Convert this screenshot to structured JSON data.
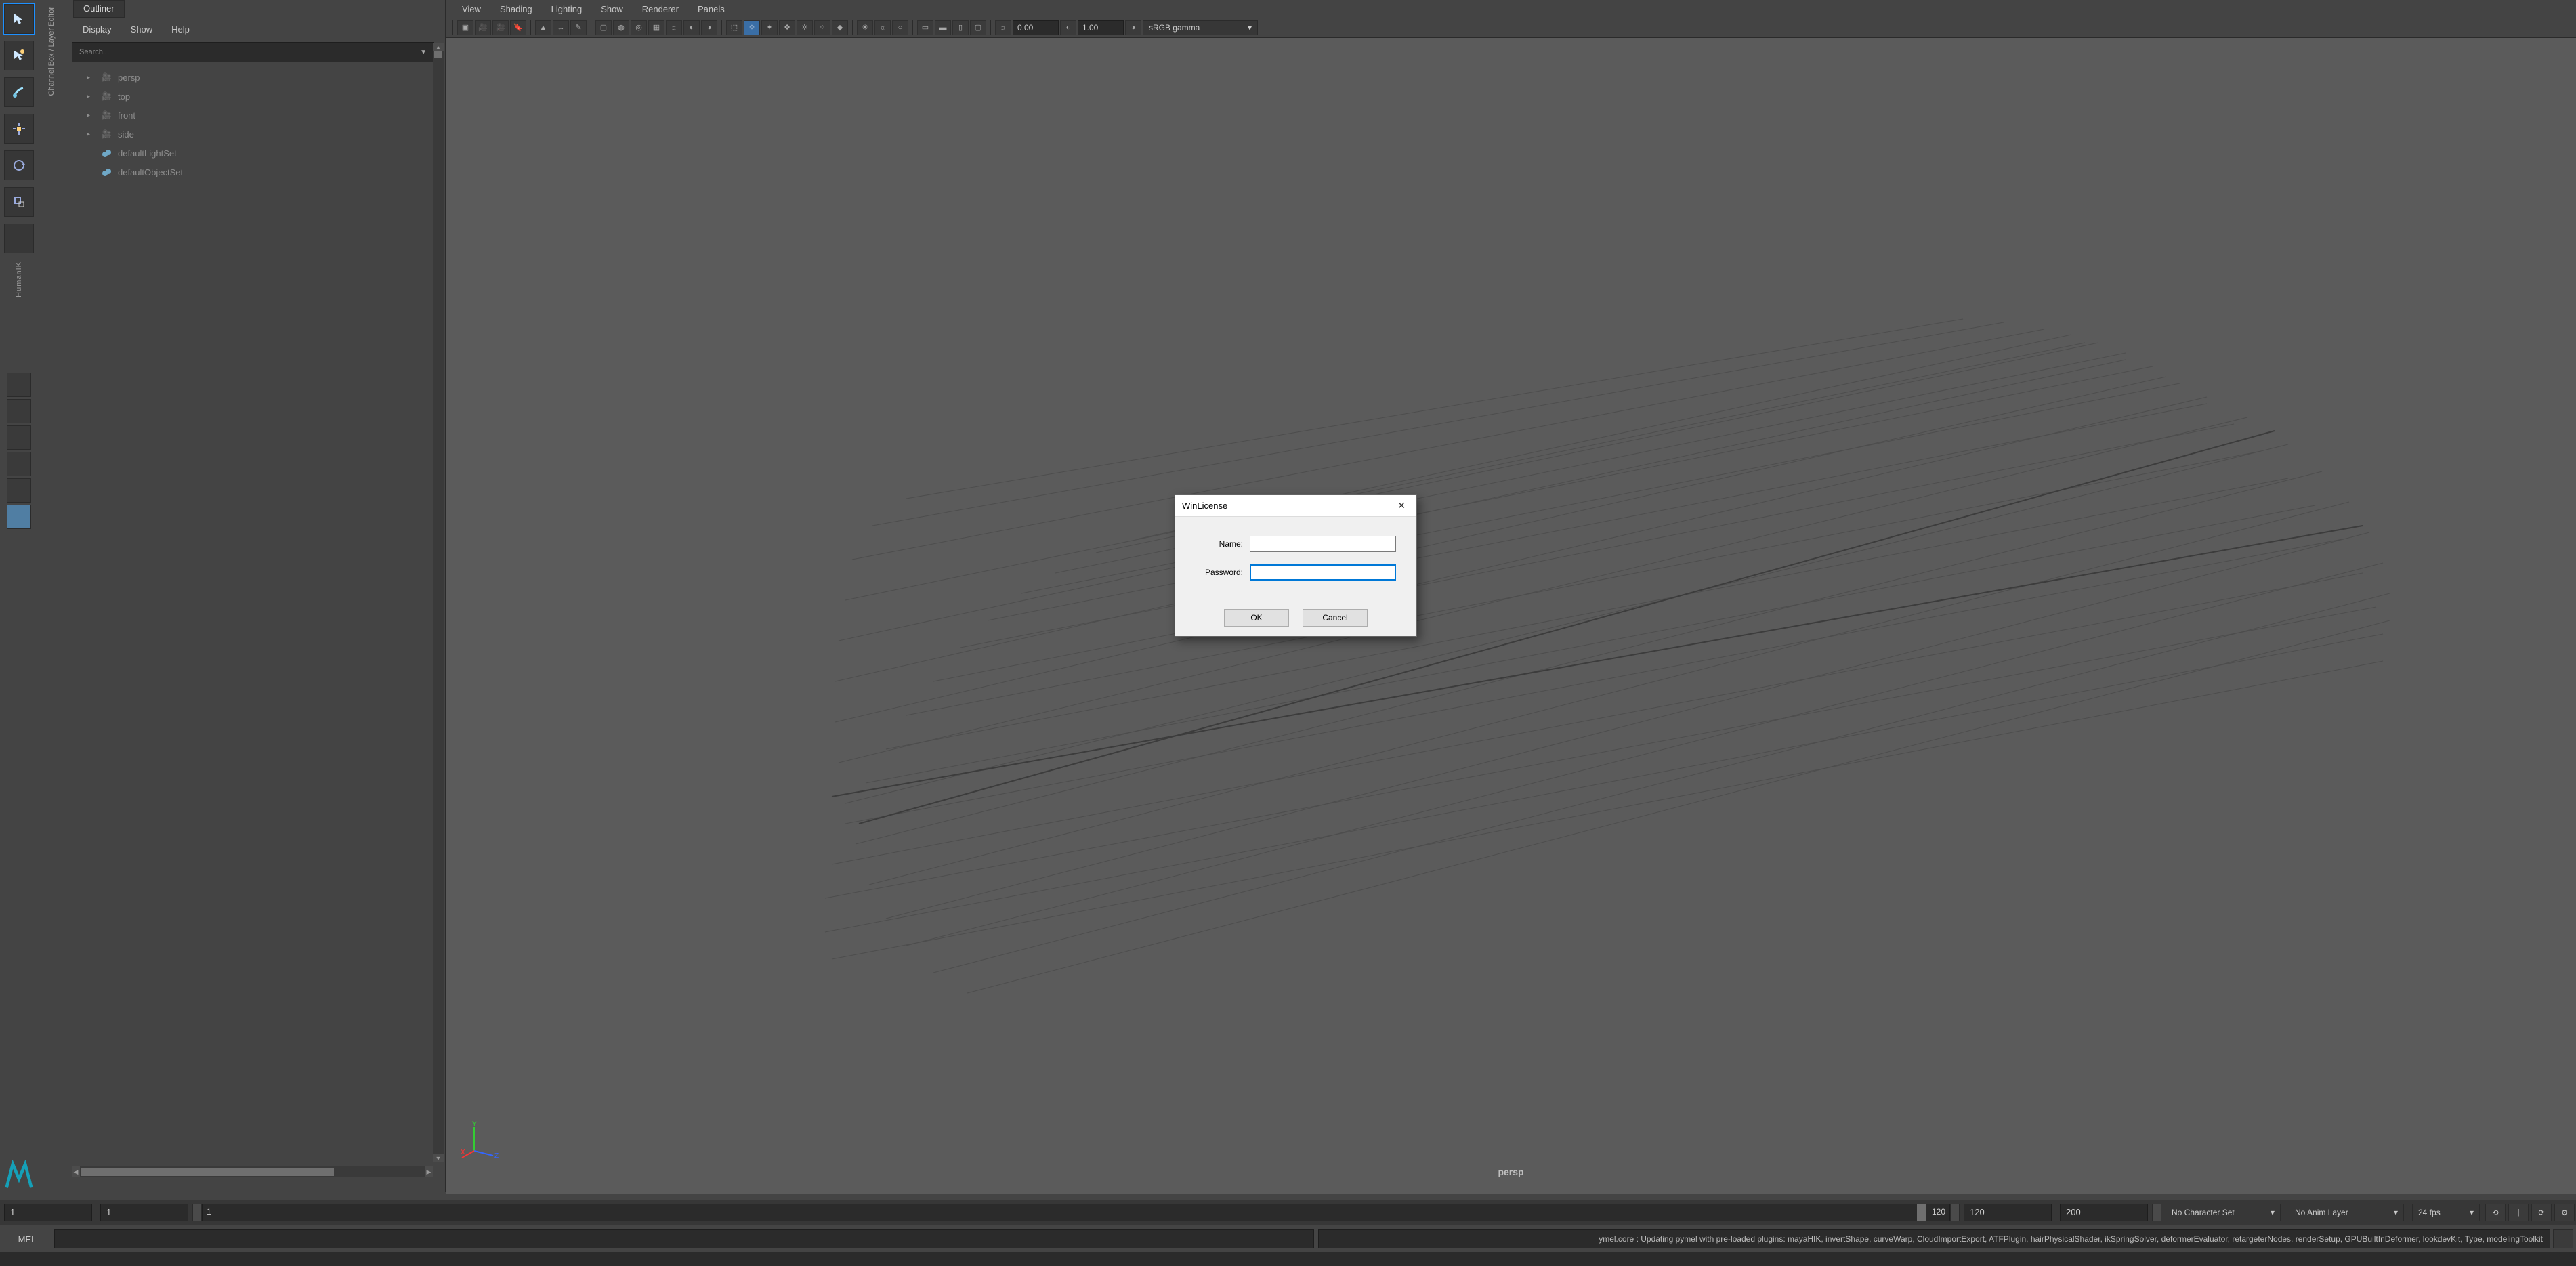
{
  "toolbox_a": {
    "label": "HumanIK"
  },
  "toolbox_b": {
    "label": "Channel Box / Layer Editor"
  },
  "outliner": {
    "tab": "Outliner",
    "menu": [
      "Display",
      "Show",
      "Help"
    ],
    "search_placeholder": "Search...",
    "items": [
      {
        "kind": "cam",
        "label": "persp",
        "expandable": true
      },
      {
        "kind": "cam",
        "label": "top",
        "expandable": true
      },
      {
        "kind": "cam",
        "label": "front",
        "expandable": true
      },
      {
        "kind": "cam",
        "label": "side",
        "expandable": true
      },
      {
        "kind": "set",
        "label": "defaultLightSet",
        "expandable": false
      },
      {
        "kind": "set",
        "label": "defaultObjectSet",
        "expandable": false
      }
    ]
  },
  "viewport": {
    "menu": [
      "View",
      "Shading",
      "Lighting",
      "Show",
      "Renderer",
      "Panels"
    ],
    "exposure": "0.00",
    "gamma": "1.00",
    "colorspace": "sRGB gamma",
    "camera_label": "persp"
  },
  "timeslider": {
    "start_range": "1",
    "start": "1",
    "tick_start": "1",
    "tick_end": "120",
    "end": "120",
    "end_range": "200",
    "charset": "No Character Set",
    "animlayer": "No Anim Layer",
    "fps": "24 fps"
  },
  "cmdline": {
    "lang": "MEL",
    "log": "ymel.core : Updating pymel with pre-loaded plugins: mayaHIK, invertShape, curveWarp, CloudImportExport, ATFPlugin, hairPhysicalShader, ikSpringSolver, deformerEvaluator, retargeterNodes, renderSetup, GPUBuiltInDeformer, lookdevKit, Type, modelingToolkit"
  },
  "dialog": {
    "title": "WinLicense",
    "name_label": "Name:",
    "password_label": "Password:",
    "name_value": "",
    "password_value": "",
    "ok": "OK",
    "cancel": "Cancel"
  }
}
